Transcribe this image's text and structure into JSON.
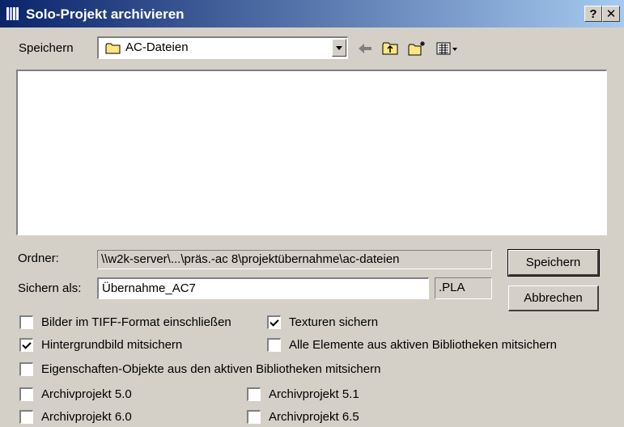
{
  "window": {
    "title": "Solo-Projekt archivieren",
    "help_label": "?",
    "close_label": "✕"
  },
  "save_in": {
    "label": "Speichern",
    "folder": "AC-Dateien"
  },
  "toolbar": {
    "back_icon": "back-arrow-icon",
    "up_icon": "up-folder-icon",
    "new_folder_icon": "new-folder-icon",
    "view_icon": "view-menu-icon"
  },
  "folder_path": {
    "label": "Ordner:",
    "value": "\\\\w2k-server\\...\\präs.-ac 8\\projektübernahme\\ac-dateien"
  },
  "save_as": {
    "label": "Sichern als:",
    "value": "Übernahme_AC7",
    "extension": ".PLA"
  },
  "buttons": {
    "save": "Speichern",
    "cancel": "Abbrechen"
  },
  "options": [
    {
      "label": "Bilder im TIFF-Format einschließen",
      "checked": false
    },
    {
      "label": "Texturen sichern",
      "checked": true
    },
    {
      "label": "Hintergrundbild mitsichern",
      "checked": true
    },
    {
      "label": "Alle Elemente aus aktiven Bibliotheken mitsichern",
      "checked": false
    },
    {
      "label": "Eigenschaften-Objekte aus den aktiven Bibliotheken mitsichern",
      "checked": false
    },
    {
      "label": "Archivprojekt 5.0",
      "checked": false
    },
    {
      "label": "Archivprojekt 5.1",
      "checked": false
    },
    {
      "label": "Archivprojekt 6.0",
      "checked": false
    },
    {
      "label": "Archivprojekt 6.5",
      "checked": false
    }
  ]
}
